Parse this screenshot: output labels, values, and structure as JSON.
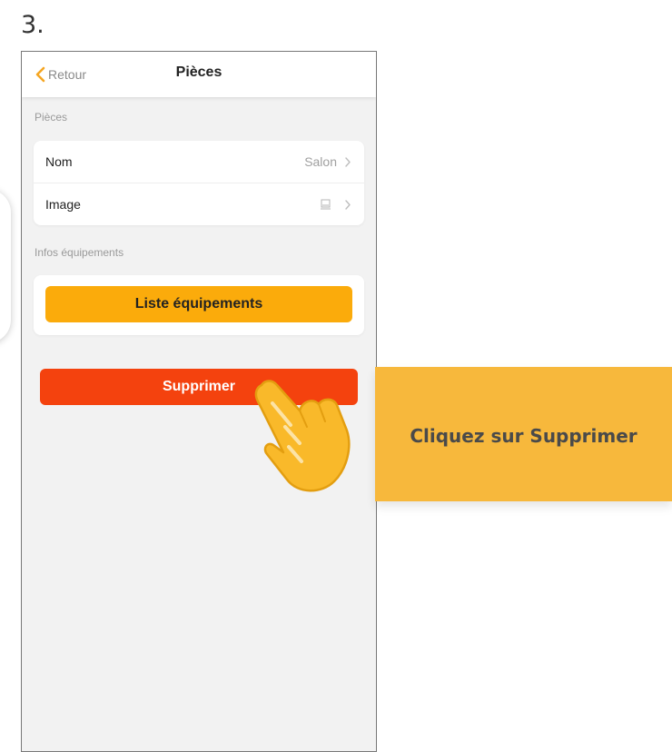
{
  "step": {
    "number": "3."
  },
  "nav": {
    "back_label": "Retour",
    "title": "Pièces"
  },
  "sections": {
    "rooms_label": "Pièces",
    "equipment_label": "Infos équipements"
  },
  "rows": {
    "name": {
      "label": "Nom",
      "value": "Salon"
    },
    "image": {
      "label": "Image"
    }
  },
  "buttons": {
    "equipment_list": "Liste équipements",
    "delete": "Supprimer"
  },
  "callout": {
    "text": "Cliquez sur Supprimer"
  },
  "colors": {
    "accent_orange": "#fbab0b",
    "danger_red": "#f4420e",
    "callout_yellow": "#f7b83c",
    "back_chevron": "#f5a623"
  },
  "icons": {
    "back": "chevron-left-icon",
    "row_chevron": "chevron-right-icon",
    "image_thumb": "image-thumbnail-icon",
    "pointer": "pointing-hand-icon"
  }
}
